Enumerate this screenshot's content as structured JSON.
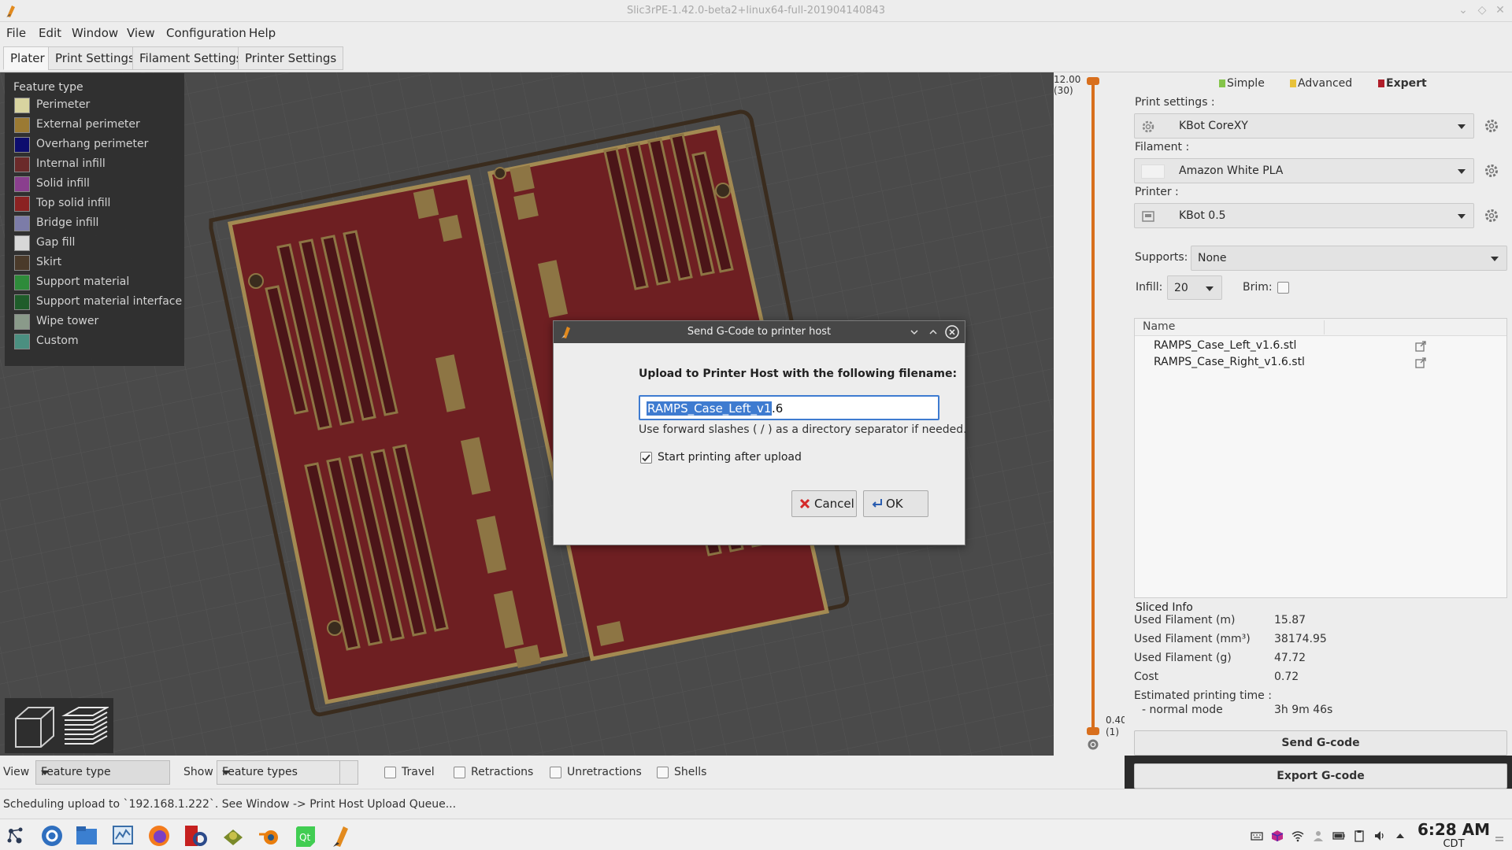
{
  "window": {
    "title": "Slic3rPE-1.42.0-beta2+linux64-full-201904140843"
  },
  "menu": [
    "File",
    "Edit",
    "Window",
    "View",
    "Configuration",
    "Help"
  ],
  "tabs": [
    "Plater",
    "Print Settings",
    "Filament Settings",
    "Printer Settings"
  ],
  "legend": {
    "title": "Feature type",
    "items": [
      {
        "label": "Perimeter",
        "color": "#d8d4a0"
      },
      {
        "label": "External perimeter",
        "color": "#9b7a33"
      },
      {
        "label": "Overhang perimeter",
        "color": "#0d0d6e"
      },
      {
        "label": "Internal infill",
        "color": "#6b2a2a"
      },
      {
        "label": "Solid infill",
        "color": "#8a3f8e"
      },
      {
        "label": "Top solid infill",
        "color": "#8b2222"
      },
      {
        "label": "Bridge infill",
        "color": "#7c7ca8"
      },
      {
        "label": "Gap fill",
        "color": "#d8d8d8"
      },
      {
        "label": "Skirt",
        "color": "#4a3a2a"
      },
      {
        "label": "Support material",
        "color": "#2e8b3a"
      },
      {
        "label": "Support material interface",
        "color": "#1f5c2a"
      },
      {
        "label": "Wipe tower",
        "color": "#8a9a8a"
      },
      {
        "label": "Custom",
        "color": "#4b8f80"
      }
    ]
  },
  "slider": {
    "top_value": "12.00",
    "top_layer": "(30)",
    "bottom_value": "0.40",
    "bottom_layer": "(1)"
  },
  "modes": {
    "simple": "Simple",
    "advanced": "Advanced",
    "expert": "Expert",
    "simple_color": "#84c44a",
    "advanced_color": "#e8c23a",
    "expert_color": "#b01e2a"
  },
  "settings": {
    "print_label": "Print settings :",
    "print_value": "KBot CoreXY",
    "filament_label": "Filament :",
    "filament_value": "Amazon White PLA",
    "printer_label": "Printer :",
    "printer_value": "KBot 0.5",
    "supports_label": "Supports:",
    "supports_value": "None",
    "infill_label": "Infill:",
    "infill_value": "20",
    "brim_label": "Brim:"
  },
  "objects": {
    "header": "Name",
    "items": [
      "RAMPS_Case_Left_v1.6.stl",
      "RAMPS_Case_Right_v1.6.stl"
    ]
  },
  "sliced_info": {
    "title": "Sliced Info",
    "rows": [
      {
        "key": "Used Filament (m)",
        "value": "15.87"
      },
      {
        "key": "Used Filament (mm³)",
        "value": "38174.95"
      },
      {
        "key": "Used Filament (g)",
        "value": "47.72"
      },
      {
        "key": "Cost",
        "value": "0.72"
      }
    ],
    "estimated_label": "Estimated printing time :",
    "normal_mode_label": "- normal mode",
    "normal_mode_value": "3h 9m 46s"
  },
  "actions": {
    "send": "Send G-code",
    "export": "Export G-code"
  },
  "viewbar": {
    "view_label": "View",
    "view_value": "Feature type",
    "show_label": "Show",
    "show_value": "Feature types",
    "travel": "Travel",
    "retractions": "Retractions",
    "unretractions": "Unretractions",
    "shells": "Shells"
  },
  "status": {
    "message": "Scheduling upload to `192.168.1.222`. See Window -> Print Host Upload Queue..."
  },
  "dialog": {
    "title": "Send G-Code to printer host",
    "prompt": "Upload to Printer Host with the following filename:",
    "filename_selected": "RAMPS_Case_Left_v1",
    "filename_rest": ".6",
    "hint": "Use forward slashes ( / ) as a directory separator if needed.",
    "checkbox_label": "Start printing after upload",
    "checkbox_checked": true,
    "cancel": "Cancel",
    "ok": "OK"
  },
  "clock": {
    "time": "6:28 AM",
    "zone": "CDT"
  }
}
